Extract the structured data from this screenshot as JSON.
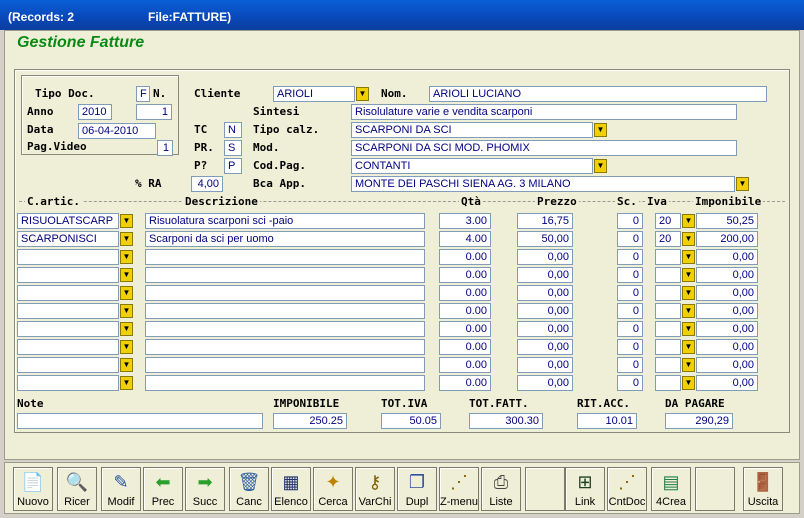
{
  "titlebar": {
    "records": "(Records: 2",
    "file": "File:FATTURE)"
  },
  "app_title": "Gestione Fatture",
  "header": {
    "tipo_doc_label": "Tipo Doc.",
    "tipo_doc_value": "F",
    "n_label": "N.",
    "anno_label": "Anno",
    "anno_value": "2010",
    "numero_value": "1",
    "data_label": "Data",
    "data_value": "06-04-2010",
    "pag_video_label": "Pag.Video",
    "pag_video_value": "1",
    "cliente_label": "Cliente",
    "cliente_value": "ARIOLI",
    "nom_label": "Nom.",
    "nom_value": "ARIOLI LUCIANO",
    "sintesi_label": "Sintesi",
    "sintesi_value": "Risolulature varie e vendita scarponi",
    "tc_label": "TC",
    "tc_value": "N",
    "tipo_calz_label": "Tipo calz.",
    "tipo_calz_value": "SCARPONI DA SCI",
    "pr_label": "PR.",
    "pr_value": "S",
    "mod_label": "Mod.",
    "mod_value": "SCARPONI DA SCI MOD. PHOMIX",
    "p_label": "P?",
    "p_value": "P",
    "cod_pag_label": "Cod.Pag.",
    "cod_pag_value": "CONTANTI",
    "ra_label": "% RA",
    "ra_value": "4,00",
    "bca_label": "Bca App.",
    "bca_value": "MONTE DEI PASCHI SIENA  AG. 3  MILANO"
  },
  "columns": {
    "cartic": "C.artic.",
    "descr": "Descrizione",
    "qta": "Qtà",
    "prezzo": "Prezzo",
    "sc": "Sc.",
    "iva": "Iva",
    "imponibile": "Imponibile"
  },
  "rows": [
    {
      "cartic": "RISUOLATSCARP",
      "descr": "Risuolatura scarponi sci -paio",
      "qta": "3.00",
      "prezzo": "16,75",
      "sc": "0",
      "iva": "20",
      "imponibile": "50,25"
    },
    {
      "cartic": "SCARPONISCI",
      "descr": "Scarponi da sci per uomo",
      "qta": "4.00",
      "prezzo": "50,00",
      "sc": "0",
      "iva": "20",
      "imponibile": "200,00"
    },
    {
      "cartic": "",
      "descr": "",
      "qta": "0.00",
      "prezzo": "0,00",
      "sc": "0",
      "iva": "",
      "imponibile": "0,00"
    },
    {
      "cartic": "",
      "descr": "",
      "qta": "0.00",
      "prezzo": "0,00",
      "sc": "0",
      "iva": "",
      "imponibile": "0,00"
    },
    {
      "cartic": "",
      "descr": "",
      "qta": "0.00",
      "prezzo": "0,00",
      "sc": "0",
      "iva": "",
      "imponibile": "0,00"
    },
    {
      "cartic": "",
      "descr": "",
      "qta": "0.00",
      "prezzo": "0,00",
      "sc": "0",
      "iva": "",
      "imponibile": "0,00"
    },
    {
      "cartic": "",
      "descr": "",
      "qta": "0.00",
      "prezzo": "0,00",
      "sc": "0",
      "iva": "",
      "imponibile": "0,00"
    },
    {
      "cartic": "",
      "descr": "",
      "qta": "0.00",
      "prezzo": "0,00",
      "sc": "0",
      "iva": "",
      "imponibile": "0,00"
    },
    {
      "cartic": "",
      "descr": "",
      "qta": "0.00",
      "prezzo": "0,00",
      "sc": "0",
      "iva": "",
      "imponibile": "0,00"
    },
    {
      "cartic": "",
      "descr": "",
      "qta": "0.00",
      "prezzo": "0,00",
      "sc": "0",
      "iva": "",
      "imponibile": "0,00"
    }
  ],
  "totals": {
    "note_label": "Note",
    "note_value": "",
    "imponibile_label": "IMPONIBILE",
    "imponibile_value": "250.25",
    "tot_iva_label": "TOT.IVA",
    "tot_iva_value": "50.05",
    "tot_fatt_label": "TOT.FATT.",
    "tot_fatt_value": "300.30",
    "rit_acc_label": "RIT.ACC.",
    "rit_acc_value": "10.01",
    "da_pagare_label": "DA PAGARE",
    "da_pagare_value": "290,29"
  },
  "toolbar": [
    {
      "label": "Nuovo",
      "icon": "new-doc-icon",
      "glyph": "📄",
      "color": "#2a9a2a"
    },
    {
      "label": "Ricer",
      "icon": "search-icon",
      "glyph": "🔍",
      "color": "#444"
    },
    {
      "label": "Modif",
      "icon": "edit-icon",
      "glyph": "✎",
      "color": "#2050a0"
    },
    {
      "label": "Prec",
      "icon": "arrow-left-icon",
      "glyph": "⬅",
      "color": "#2aa02a"
    },
    {
      "label": "Succ",
      "icon": "arrow-right-icon",
      "glyph": "➡",
      "color": "#2aa02a"
    },
    {
      "label": "Canc",
      "icon": "trash-icon",
      "glyph": "🗑",
      "color": "#3060a0"
    },
    {
      "label": "Elenco",
      "icon": "list-icon",
      "glyph": "▦",
      "color": "#203070"
    },
    {
      "label": "Cerca",
      "icon": "find-icon",
      "glyph": "✦",
      "color": "#c08000"
    },
    {
      "label": "VarChi",
      "icon": "keys-icon",
      "glyph": "⚷",
      "color": "#806000"
    },
    {
      "label": "Dupl",
      "icon": "duplicate-icon",
      "glyph": "❐",
      "color": "#3050a0"
    },
    {
      "label": "Z-menu",
      "icon": "menu-icon",
      "glyph": "⋰",
      "color": "#806000"
    },
    {
      "label": "Liste",
      "icon": "printer-icon",
      "glyph": "⎙",
      "color": "#444"
    },
    {
      "label": "",
      "icon": "blank-icon",
      "glyph": "",
      "color": "#000"
    },
    {
      "label": "Link",
      "icon": "link-tree-icon",
      "glyph": "⊞",
      "color": "#204020"
    },
    {
      "label": "CntDoc",
      "icon": "count-doc-icon",
      "glyph": "⋰",
      "color": "#806000"
    },
    {
      "label": "4Crea",
      "icon": "create-chart-icon",
      "glyph": "▤",
      "color": "#208040"
    },
    {
      "label": "",
      "icon": "blank-icon",
      "glyph": "",
      "color": "#000"
    },
    {
      "label": "Uscita",
      "icon": "exit-door-icon",
      "glyph": "🚪",
      "color": "#c00000"
    }
  ]
}
